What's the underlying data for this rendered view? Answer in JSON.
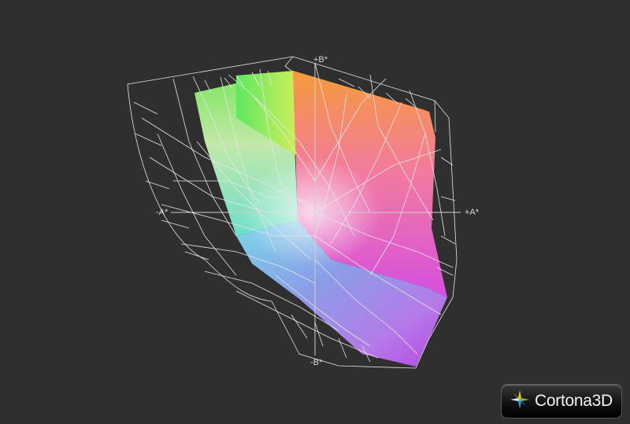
{
  "viewer": {
    "axis_labels": {
      "b_plus": "+B*",
      "a_minus": "-A*",
      "a_plus": "+A*",
      "b_minus": "-B*"
    }
  },
  "brand": {
    "name": "Cortona3D",
    "logo_icon": "cortona-star-icon",
    "colors": {
      "star_green": "#7bc043",
      "star_yellow": "#f2c200",
      "star_blue": "#2a9fd8",
      "star_white": "#e8e8e8"
    }
  },
  "colors": {
    "background": "#2f2f2f",
    "wireframe": "#e6e6e6",
    "axis": "#cfcfcf"
  }
}
